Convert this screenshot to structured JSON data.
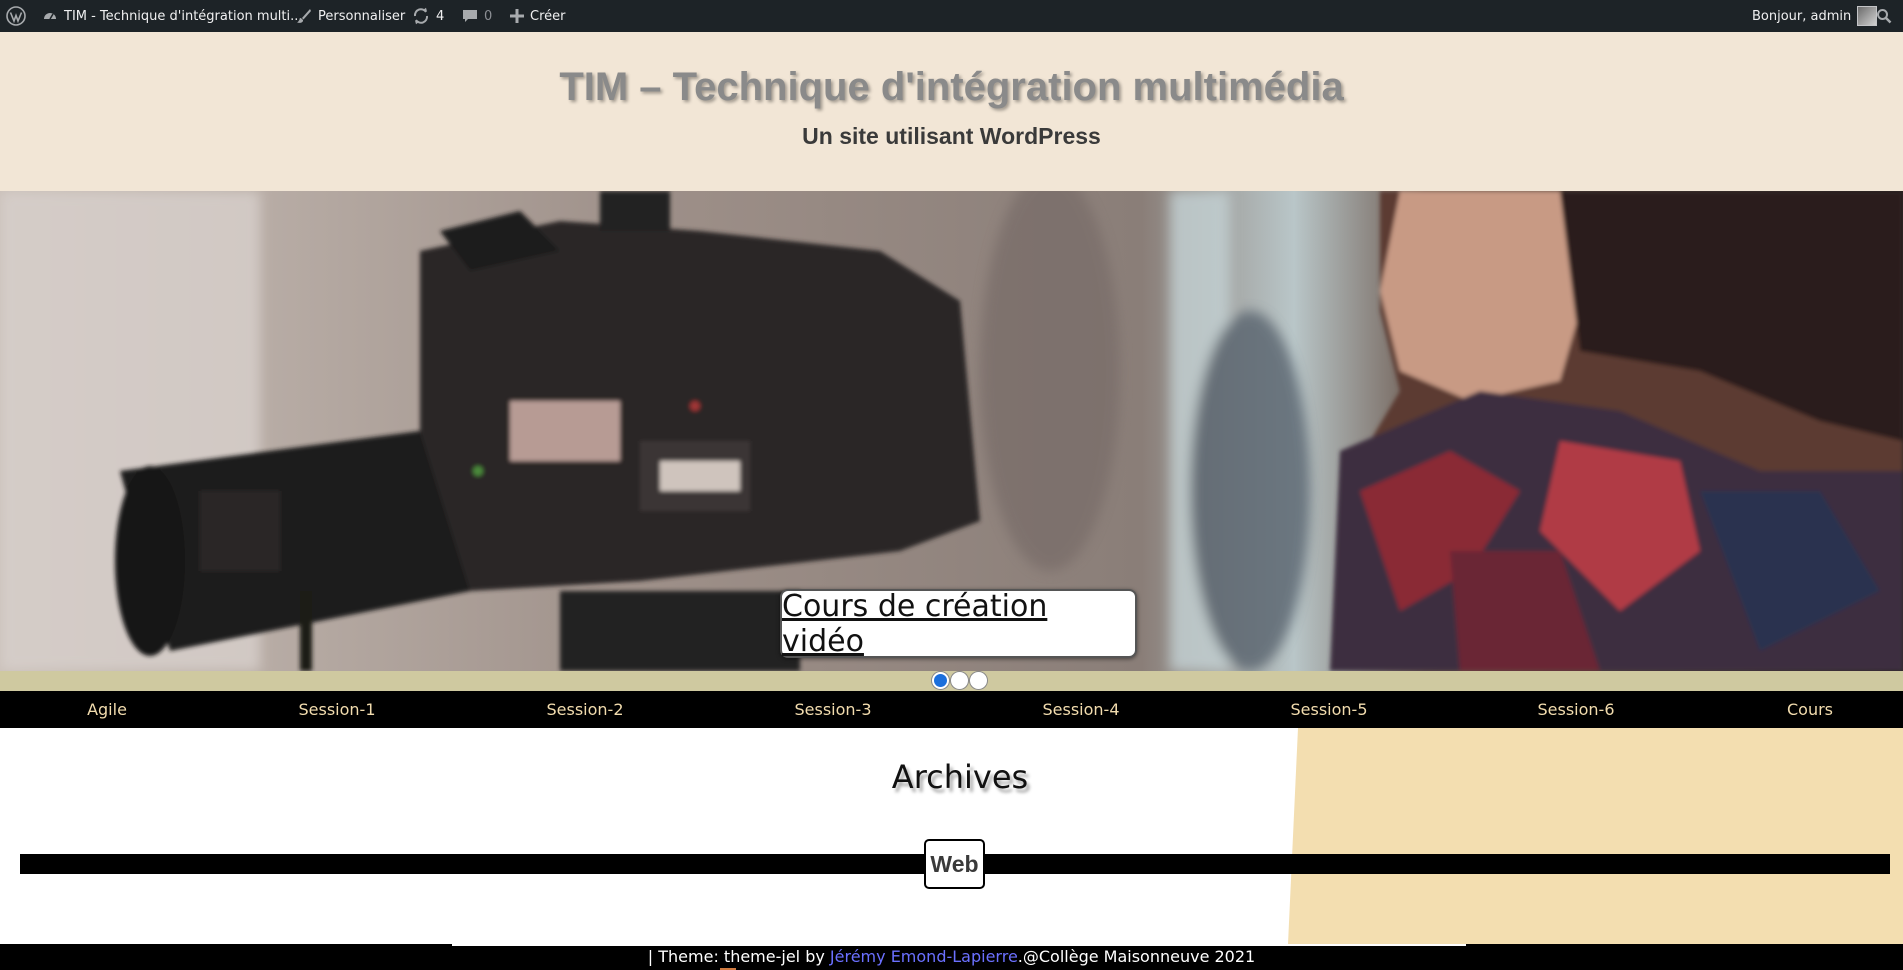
{
  "adminbar": {
    "wp_logo_icon": "wordpress-logo-icon",
    "site_name": "TIM - Technique d'intégration multi...",
    "customize": "Personnaliser",
    "updates_count": "4",
    "comments_count": "0",
    "new": "Créer",
    "greeting": "Bonjour, admin"
  },
  "header": {
    "title": "TIM – Technique d'intégration multimédia",
    "description": "Un site utilisant WordPress"
  },
  "slider": {
    "caption": "Cours de création vidéo",
    "dots": 3,
    "active_dot": 0
  },
  "nav": {
    "items": [
      {
        "label": "Agile"
      },
      {
        "label": "Session-1"
      },
      {
        "label": "Session-2"
      },
      {
        "label": "Session-3"
      },
      {
        "label": "Session-4"
      },
      {
        "label": "Session-5"
      },
      {
        "label": "Session-6"
      },
      {
        "label": "Cours"
      }
    ]
  },
  "main": {
    "heading": "Archives",
    "category": "Web"
  },
  "footer": {
    "prefix": "| Theme: theme-jel by ",
    "author": "Jérémy Emond-Lapierre",
    "suffix": ".@Collège Maisonneuve 2021"
  },
  "colors": {
    "adminbar": "#1d2327",
    "header_bg": "#f2e6d6",
    "nav_bg": "#000000",
    "nav_text": "#f2dcae",
    "dots_bar": "#cfc9a0",
    "active_dot": "#1b6fdc",
    "sidebar_beige": "#f3deb0",
    "footer_link": "#6b70ff"
  }
}
